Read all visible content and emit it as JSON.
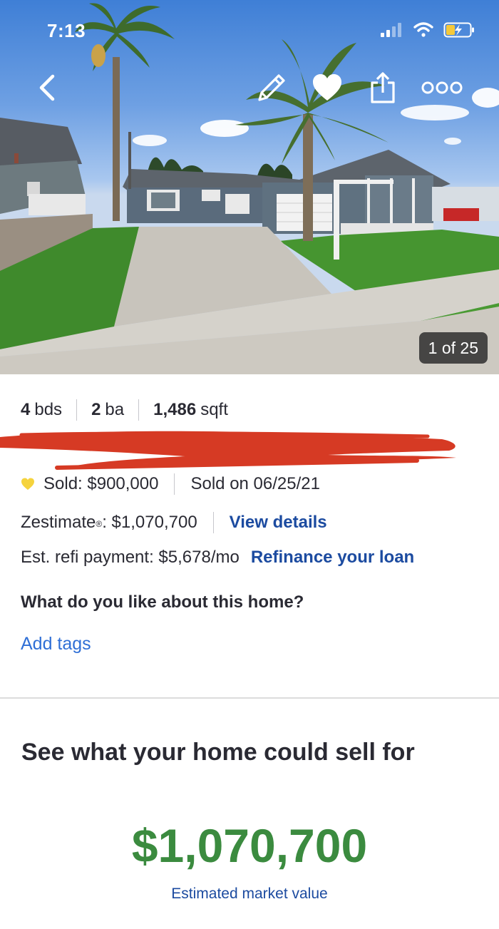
{
  "status_bar": {
    "time": "7:13"
  },
  "photo": {
    "counter": "1 of 25"
  },
  "toolbar": {
    "back_icon": "chevron-left-icon",
    "edit_icon": "pencil-icon",
    "save_icon": "heart-icon",
    "share_icon": "share-icon",
    "more_icon": "more-icon"
  },
  "facts": {
    "beds_num": "4",
    "beds_unit": "bds",
    "baths_num": "2",
    "baths_unit": "ba",
    "sqft_num": "1,486",
    "sqft_unit": "sqft"
  },
  "sale": {
    "sold_price": "Sold: $900,000",
    "sold_date": "Sold on 06/25/21"
  },
  "zestimate": {
    "label": "Zestimate",
    "mark": "®",
    "value": ": $1,070,700",
    "link": "View details"
  },
  "refi": {
    "text": "Est. refi payment: $5,678/mo",
    "link": "Refinance your loan"
  },
  "tags": {
    "question": "What do you like about this home?",
    "add": "Add tags"
  },
  "sell": {
    "heading": "See what your home could sell for",
    "value": "$1,070,700",
    "caption": "Estimated market value"
  },
  "colors": {
    "accent_blue": "#1c4ba0",
    "link_blue": "#2f6fd6",
    "value_green": "#3b8b3f",
    "heart_yellow": "#f5d33d",
    "redaction_red": "#d63a24"
  }
}
